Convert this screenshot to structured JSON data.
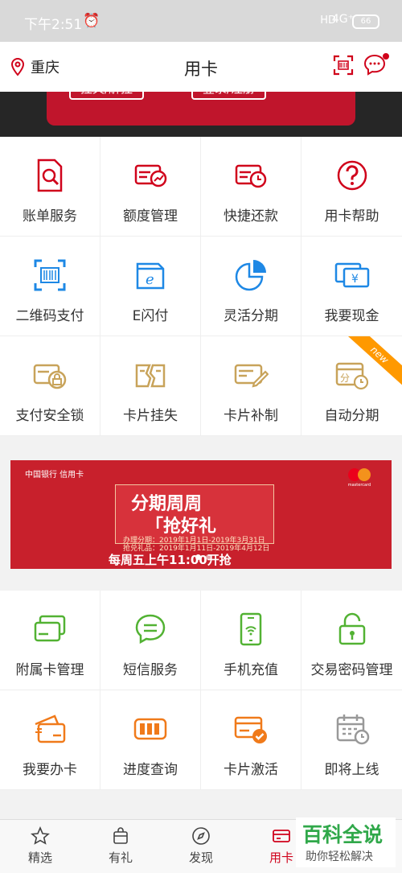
{
  "status": {
    "time": "下午2:51",
    "signal": "HD",
    "network": "4G⁺",
    "battery": "66"
  },
  "header": {
    "location": "重庆",
    "title": "用卡"
  },
  "card_band": {
    "btn_left": "挂失/解挂",
    "btn_right": "登录/注册"
  },
  "grid1": [
    {
      "label": "账单服务",
      "icon": "bill-search-icon"
    },
    {
      "label": "额度管理",
      "icon": "credit-limit-icon"
    },
    {
      "label": "快捷还款",
      "icon": "quick-repay-icon"
    },
    {
      "label": "用卡帮助",
      "icon": "help-icon"
    },
    {
      "label": "二维码支付",
      "icon": "qr-scan-icon"
    },
    {
      "label": "E闪付",
      "icon": "e-pay-icon"
    },
    {
      "label": "灵活分期",
      "icon": "pie-chart-icon"
    },
    {
      "label": "我要现金",
      "icon": "cash-icon"
    },
    {
      "label": "支付安全锁",
      "icon": "security-lock-icon"
    },
    {
      "label": "卡片挂失",
      "icon": "card-lost-icon"
    },
    {
      "label": "卡片补制",
      "icon": "card-reissue-icon"
    },
    {
      "label": "自动分期",
      "icon": "auto-installment-icon",
      "tag": "new"
    }
  ],
  "banner": {
    "bank": "中国银行 信用卡",
    "brand": "mastercard",
    "headline1": "分期周周",
    "headline2": "「抢好礼",
    "line1": "办理分期：2019年1月1日-2019年3月31日",
    "line2": "抢兑礼品：2019年1月11日-2019年4月12日",
    "footer": "每周五上午11:00开抢"
  },
  "grid2": [
    {
      "label": "附属卡管理",
      "icon": "supplementary-card-icon"
    },
    {
      "label": "短信服务",
      "icon": "sms-icon"
    },
    {
      "label": "手机充值",
      "icon": "phone-topup-icon"
    },
    {
      "label": "交易密码管理",
      "icon": "password-lock-icon"
    },
    {
      "label": "我要办卡",
      "icon": "apply-card-icon"
    },
    {
      "label": "进度查询",
      "icon": "progress-icon"
    },
    {
      "label": "卡片激活",
      "icon": "card-activate-icon"
    },
    {
      "label": "即将上线",
      "icon": "calendar-clock-icon"
    }
  ],
  "tabs": [
    {
      "label": "精选",
      "icon": "star-icon"
    },
    {
      "label": "有礼",
      "icon": "gift-bag-icon"
    },
    {
      "label": "发现",
      "icon": "compass-icon"
    },
    {
      "label": "用卡",
      "icon": "card-icon",
      "active": true
    }
  ],
  "watermark": {
    "title": "百科全说",
    "subtitle": "助你轻松解决"
  },
  "colors": {
    "red": "#d0021b",
    "gold": "#c8a35a",
    "blue": "#1e88e5",
    "green": "#52b233",
    "orange": "#f07a1a"
  }
}
